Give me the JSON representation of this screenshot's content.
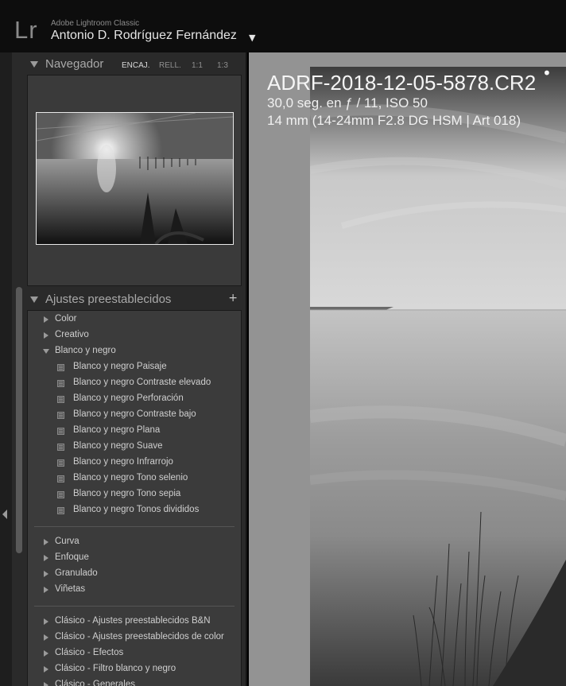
{
  "identity": {
    "logo": "Lr",
    "app_name": "Adobe Lightroom Classic",
    "user_name": "Antonio D. Rodríguez Fernández",
    "user_menu_arrow": "▼"
  },
  "navigator": {
    "title": "Navegador",
    "zoom_options": [
      "ENCAJ.",
      "RELL.",
      "1:1",
      "1:3"
    ],
    "active_zoom": "ENCAJ."
  },
  "presets": {
    "title": "Ajustes preestablecidos",
    "add_icon": "+",
    "groups_top": [
      {
        "label": "Color",
        "expanded": false
      },
      {
        "label": "Creativo",
        "expanded": false
      },
      {
        "label": "Blanco y negro",
        "expanded": true
      }
    ],
    "bw_items": [
      "Blanco y negro Paisaje",
      "Blanco y negro Contraste elevado",
      "Blanco y negro Perforación",
      "Blanco y negro Contraste bajo",
      "Blanco y negro Plana",
      "Blanco y negro Suave",
      "Blanco y negro Infrarrojo",
      "Blanco y negro Tono selenio",
      "Blanco y negro Tono sepia",
      "Blanco y negro Tonos divididos"
    ],
    "groups_mid": [
      "Curva",
      "Enfoque",
      "Granulado",
      "Viñetas"
    ],
    "groups_bottom": [
      "Clásico - Ajustes preestablecidos B&N",
      "Clásico - Ajustes preestablecidos de color",
      "Clásico - Efectos",
      "Clásico - Filtro blanco y negro",
      "Clásico - Generales"
    ]
  },
  "photo_info": {
    "file_name": "ADRF-2018-12-05-5878.CR2",
    "exif_line1": "30,0 seg. en ƒ / 11, ISO 50",
    "exif_line2": "14 mm (14-24mm F2.8 DG HSM | Art 018)"
  },
  "colors": {
    "panel_bg": "#2a2a2a",
    "content_bg": "#3b3b3b",
    "main_bg": "#939393",
    "text_light": "#cfcfcf"
  }
}
